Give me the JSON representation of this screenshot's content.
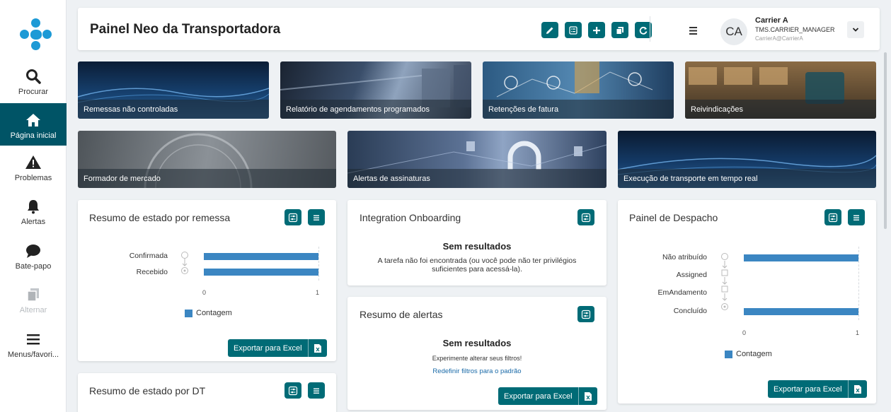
{
  "sidebar": {
    "items": [
      {
        "label": "Procurar",
        "icon": "search-icon"
      },
      {
        "label": "Página inicial",
        "icon": "home-icon"
      },
      {
        "label": "Problemas",
        "icon": "warning-icon"
      },
      {
        "label": "Alertas",
        "icon": "bell-icon"
      },
      {
        "label": "Bate-papo",
        "icon": "chat-icon"
      },
      {
        "label": "Alternar",
        "icon": "switch-icon"
      },
      {
        "label": "Menus/favori...",
        "icon": "menu-icon"
      }
    ]
  },
  "header": {
    "title": "Painel Neo da Transportadora",
    "user": {
      "initials": "CA",
      "name": "Carrier A",
      "role": "TMS.CARRIER_MANAGER",
      "email": "CarrierA@CarrierA"
    }
  },
  "tiles": [
    {
      "label": "Remessas não controladas"
    },
    {
      "label": "Relatório de agendamentos programados"
    },
    {
      "label": "Retenções de fatura"
    },
    {
      "label": "Reivindicações"
    },
    {
      "label": "Formador de mercado"
    },
    {
      "label": "Alertas de assinaturas"
    },
    {
      "label": "Execução de transporte em tempo real"
    }
  ],
  "cards": {
    "status_shipment": {
      "title": "Resumo de estado por remessa",
      "categories": [
        "Confirmada",
        "Recebido"
      ],
      "values": [
        1,
        1
      ],
      "ticks": [
        "0",
        "1"
      ],
      "legend": "Contagem",
      "export_label": "Exportar para Excel"
    },
    "integration": {
      "title": "Integration Onboarding",
      "no_results": "Sem resultados",
      "message": "A tarefa não foi encontrada (ou você pode não ter privilégios suficientes para acessá-la)."
    },
    "alerts_summary": {
      "title": "Resumo de alertas",
      "no_results": "Sem resultados",
      "message": "Experimente alterar seus filtros!",
      "reset_link": "Redefinir filtros para o padrão",
      "export_label": "Exportar para Excel"
    },
    "dispatch": {
      "title": "Painel de Despacho",
      "categories": [
        "Não atribuído",
        "Assigned",
        "EmAndamento",
        "Concluído"
      ],
      "values": [
        1,
        0,
        0,
        1
      ],
      "ticks": [
        "0",
        "1"
      ],
      "legend": "Contagem",
      "export_label": "Exportar para Excel"
    },
    "status_dt": {
      "title": "Resumo de estado por DT"
    }
  },
  "colors": {
    "primary": "#006b76",
    "sidebar_active": "#005466",
    "bar": "#3b86c2",
    "link": "#1a6aa8"
  }
}
